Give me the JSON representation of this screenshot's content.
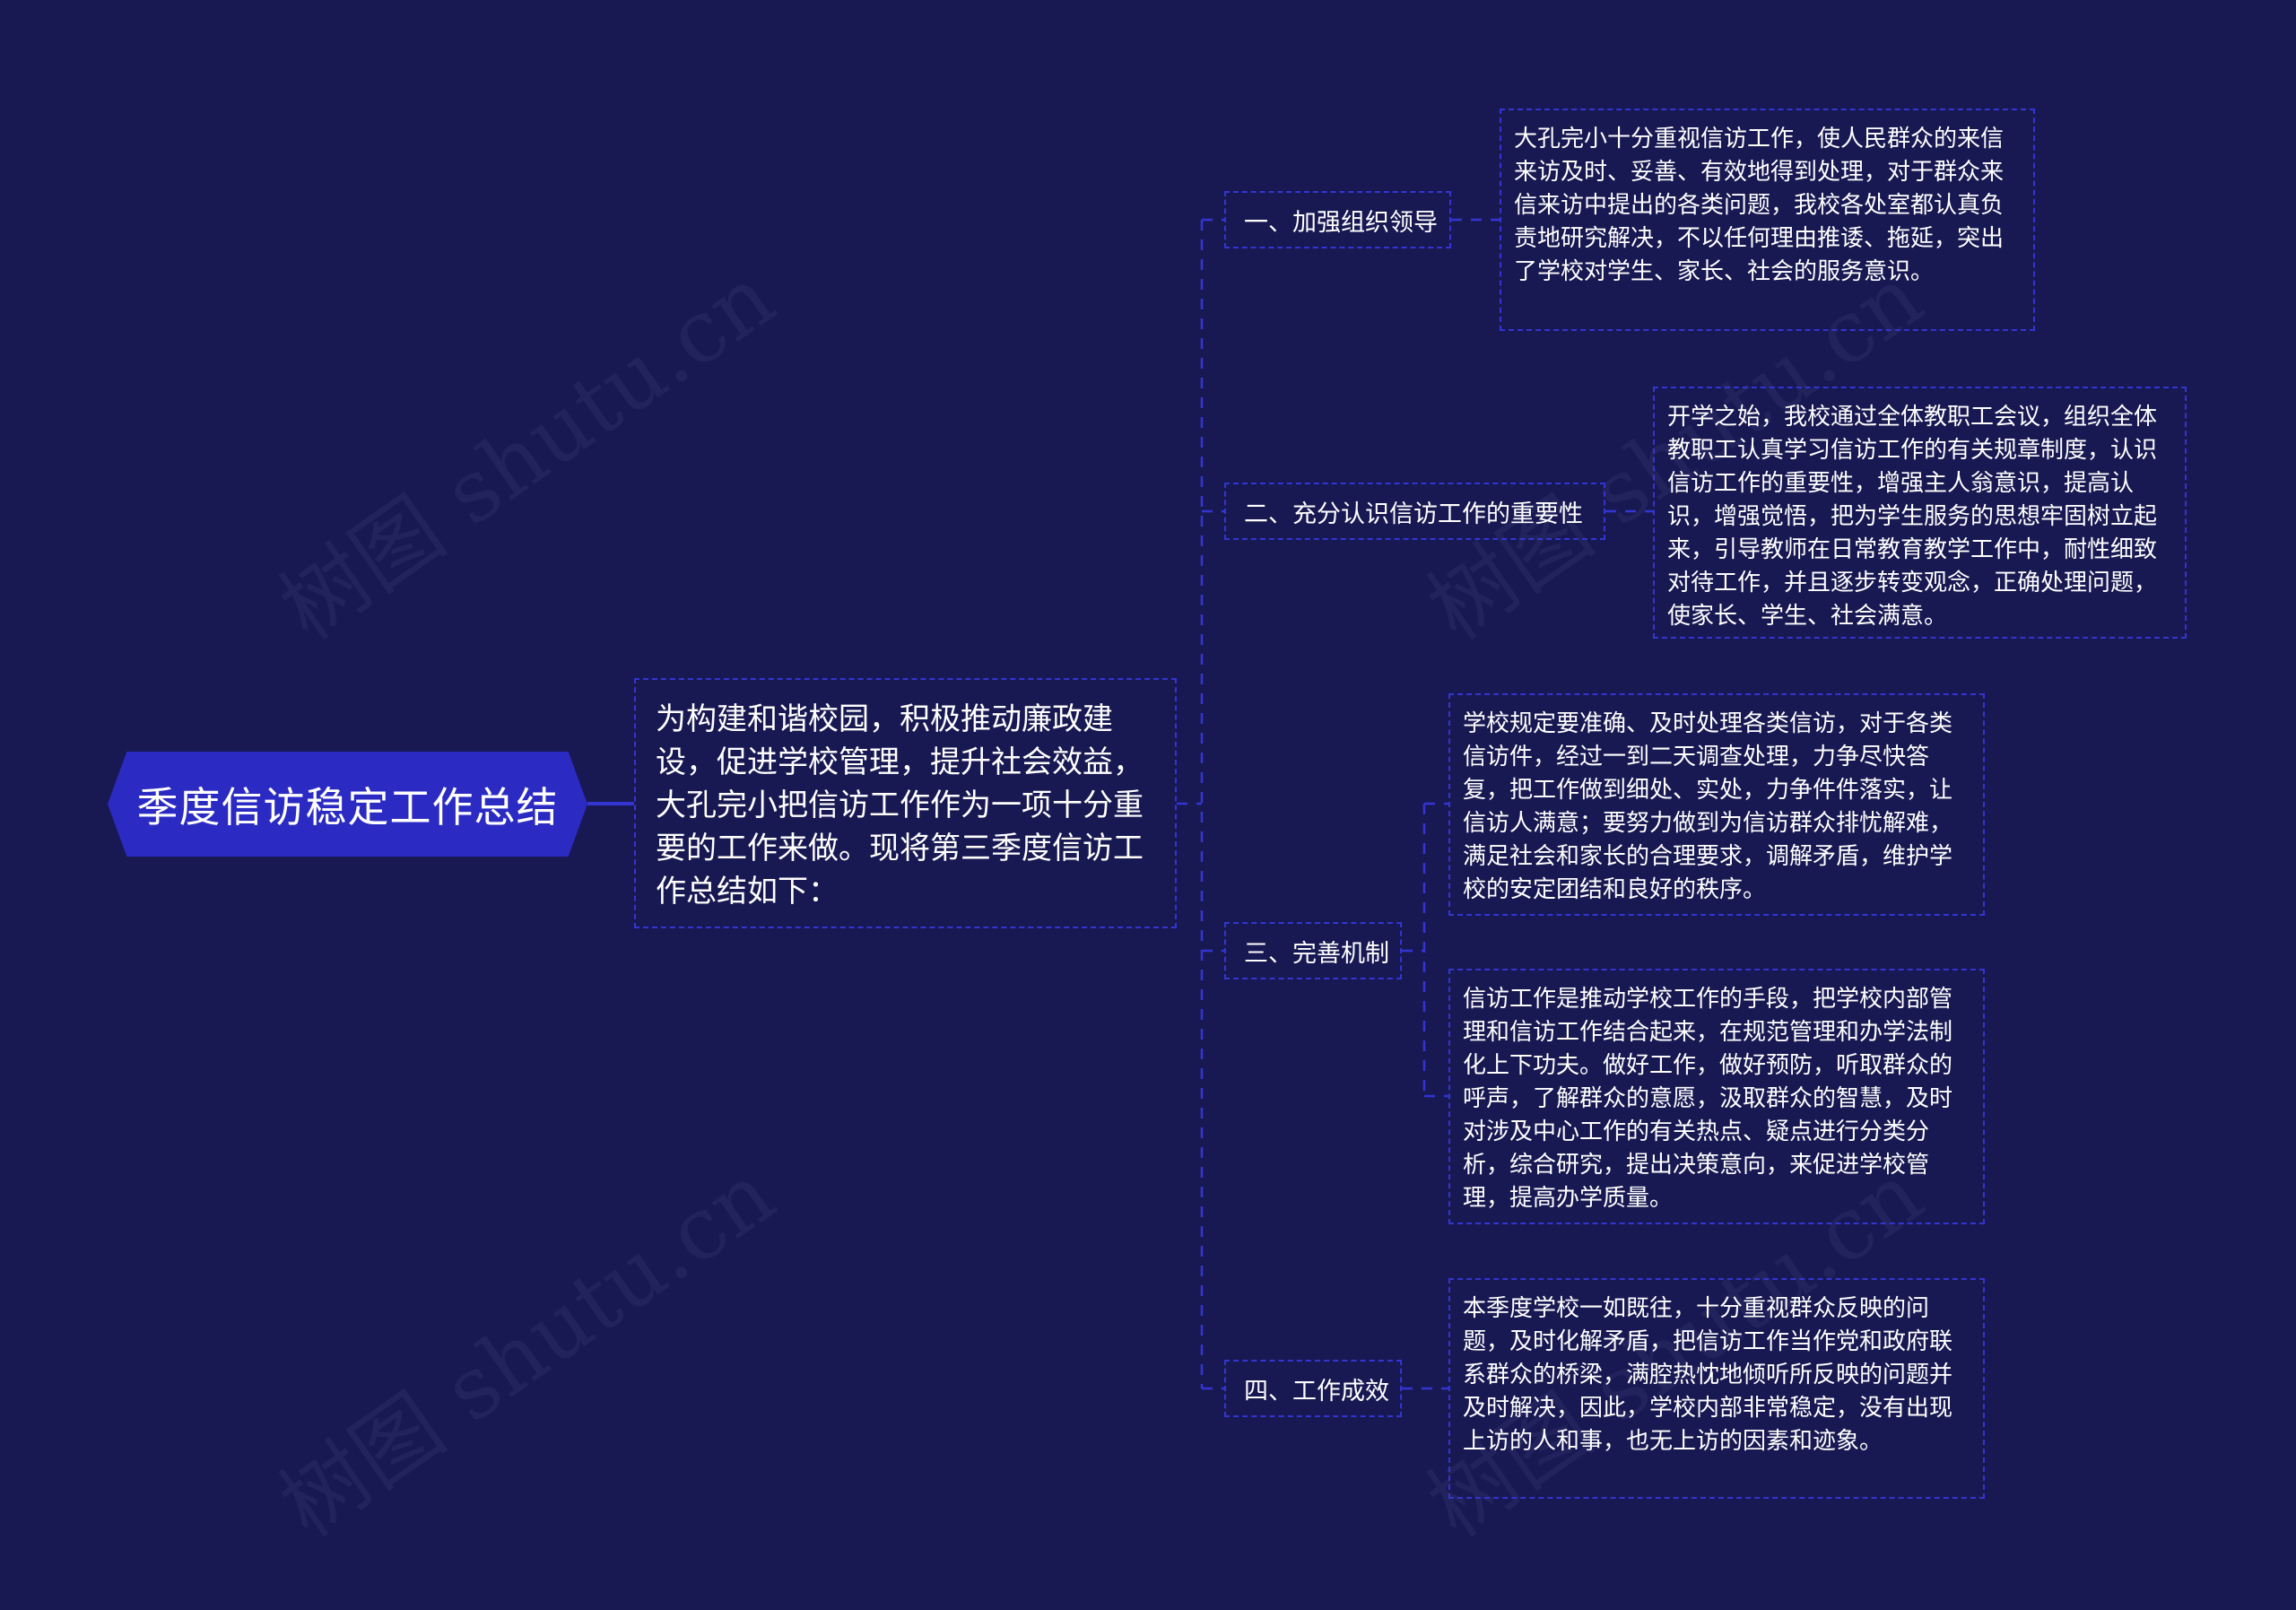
{
  "watermark": {
    "text": "树图 shutu.cn"
  },
  "colors": {
    "background": "#181952",
    "root_fill": "#2b2bc4",
    "connector": "#3434d2",
    "text": "#ffffff"
  },
  "root": {
    "title": "季度信访稳定工作总结"
  },
  "intro": {
    "text": "为构建和谐校园，积极推动廉政建设，促进学校管理，提升社会效益，大孔完小把信访工作作为一项十分重要的工作来做。现将第三季度信访工作总结如下："
  },
  "branches": [
    {
      "label": "一、加强组织领导",
      "details": [
        "大孔完小十分重视信访工作，使人民群众的来信来访及时、妥善、有效地得到处理，对于群众来信来访中提出的各类问题，我校各处室都认真负责地研究解决，不以任何理由推诿、拖延，突出了学校对学生、家长、社会的服务意识。"
      ]
    },
    {
      "label": "二、充分认识信访工作的重要性",
      "details": [
        "开学之始，我校通过全体教职工会议，组织全体教职工认真学习信访工作的有关规章制度，认识信访工作的重要性，增强主人翁意识，提高认识，增强觉悟，把为学生服务的思想牢固树立起来，引导教师在日常教育教学工作中，耐性细致对待工作，并且逐步转变观念，正确处理问题，使家长、学生、社会满意。"
      ]
    },
    {
      "label": "三、完善机制",
      "details": [
        "学校规定要准确、及时处理各类信访，对于各类信访件，经过一到二天调查处理，力争尽快答复，把工作做到细处、实处，力争件件落实，让信访人满意；要努力做到为信访群众排忧解难，满足社会和家长的合理要求，调解矛盾，维护学校的安定团结和良好的秩序。",
        "信访工作是推动学校工作的手段，把学校内部管理和信访工作结合起来，在规范管理和办学法制化上下功夫。做好工作，做好预防，听取群众的呼声，了解群众的意愿，汲取群众的智慧，及时对涉及中心工作的有关热点、疑点进行分类分析，综合研究，提出决策意向，来促进学校管理，提高办学质量。"
      ]
    },
    {
      "label": "四、工作成效",
      "details": [
        "本季度学校一如既往，十分重视群众反映的问题，及时化解矛盾，把信访工作当作党和政府联系群众的桥梁，满腔热忱地倾听所反映的问题并及时解决，因此，学校内部非常稳定，没有出现上访的人和事，也无上访的因素和迹象。"
      ]
    }
  ]
}
